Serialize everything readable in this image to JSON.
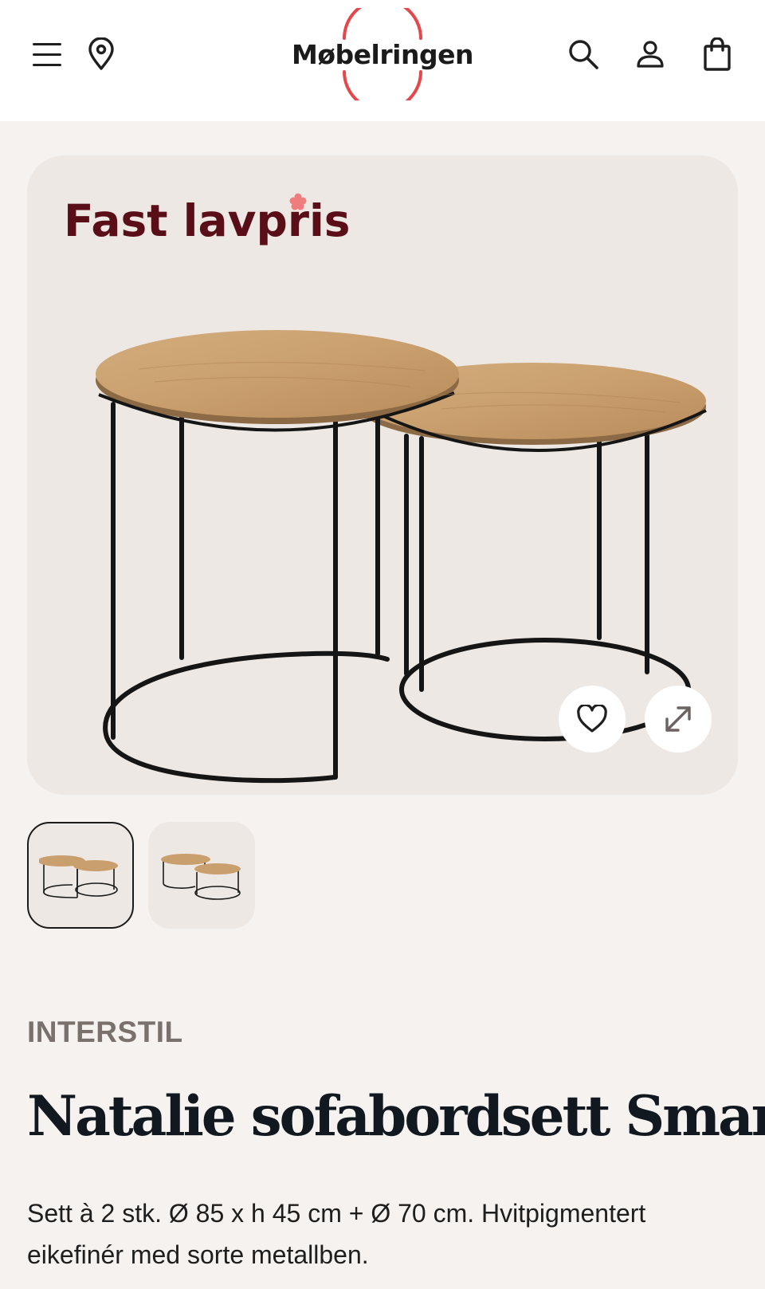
{
  "header": {
    "logo_text": "Møbelringen",
    "brand_color": "#e5474b",
    "icons": [
      "menu-icon",
      "location-pin-icon",
      "search-icon",
      "user-icon",
      "shopping-bag-icon"
    ]
  },
  "hero": {
    "badge_text": "Fast lavpris",
    "badge_color": "#5a0f18",
    "favorite_icon": "heart-icon",
    "expand_icon": "expand-arrows-icon"
  },
  "thumbnails": {
    "count": 2,
    "selected_index": 0
  },
  "product": {
    "brand": "INTERSTIL",
    "title": "Natalie sofabordsett Smart",
    "description": "Sett à 2 stk. Ø 85 x h 45 cm + Ø 70 cm. Hvitpigmentert eikefinér med sorte metallben."
  }
}
